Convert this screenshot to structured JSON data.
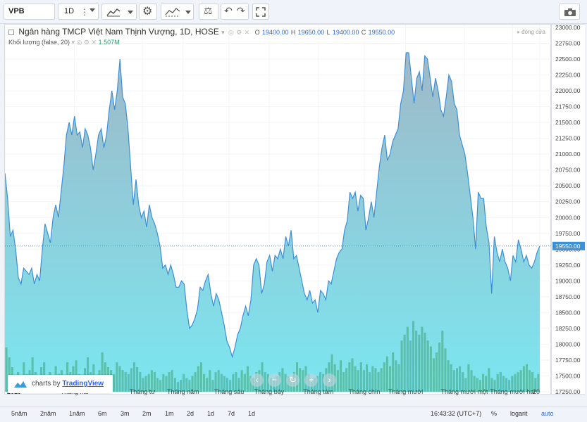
{
  "toolbar": {
    "symbol": "VPB",
    "interval": "1D",
    "icons": [
      "more-icon",
      "dropdown-icon",
      "area-style-icon",
      "dropdown-icon",
      "settings-icon",
      "indicators-icon",
      "dropdown-icon",
      "compare-icon",
      "undo-icon",
      "redo-icon",
      "fullscreen-icon",
      "camera-icon"
    ]
  },
  "legend": {
    "title": "Ngân hàng TMCP Việt Nam Thịnh Vượng, 1D, HOSE",
    "o_label": "O",
    "o_value": "19400.00",
    "h_label": "H",
    "h_value": "19650.00",
    "l_label": "L",
    "l_value": "19400.00",
    "c_label": "C",
    "c_value": "19550.00",
    "volume_label": "Khối lượng (false, 20)",
    "volume_value": "1.507M",
    "close_label": "đóng cửa"
  },
  "watermark": {
    "prefix": "charts by",
    "brand": "TradingView"
  },
  "bottom": {
    "ranges": [
      "5năm",
      "2năm",
      "1năm",
      "6m",
      "3m",
      "2m",
      "1m",
      "2d",
      "1d",
      "7d",
      "1d"
    ],
    "time": "16:43:32 (UTC+7)",
    "pct": "%",
    "log": "logarit",
    "auto": "auto"
  },
  "colors": {
    "line": "#3d8fd8",
    "volume": "#3fa276",
    "area_top": "#9fb9c8",
    "area_bottom": "#7be6f0",
    "last_price_bg": "#3d8fd8"
  },
  "chart_data": {
    "type": "area",
    "ylim": [
      17250,
      23000
    ],
    "y_ticks": [
      17250,
      17500,
      17750,
      18000,
      18250,
      18500,
      18750,
      19000,
      19250,
      19500,
      19750,
      20000,
      20250,
      20500,
      20750,
      21000,
      21250,
      21500,
      21750,
      22000,
      22250,
      22500,
      22750,
      23000
    ],
    "last_price": "19550.00",
    "x_tick_labels": [
      "2019",
      "Tháng hai",
      "Tháng tư",
      "Tháng năm",
      "Tháng sáu",
      "Tháng bảy",
      "Tháng tám",
      "Tháng chín",
      "Tháng mười",
      "Tháng mười một",
      "Tháng mười hai",
      "20"
    ],
    "x_tick_pos": [
      0.0,
      0.13,
      0.257,
      0.333,
      0.419,
      0.494,
      0.586,
      0.672,
      0.749,
      0.859,
      0.949,
      1.0
    ],
    "points": [
      [
        0.0,
        20700
      ],
      [
        0.005,
        20300
      ],
      [
        0.01,
        19700
      ],
      [
        0.015,
        19800
      ],
      [
        0.02,
        19500
      ],
      [
        0.025,
        19050
      ],
      [
        0.03,
        18950
      ],
      [
        0.035,
        19200
      ],
      [
        0.04,
        19150
      ],
      [
        0.045,
        19100
      ],
      [
        0.05,
        19200
      ],
      [
        0.055,
        18950
      ],
      [
        0.06,
        19100
      ],
      [
        0.065,
        19000
      ],
      [
        0.07,
        19500
      ],
      [
        0.075,
        19900
      ],
      [
        0.08,
        19750
      ],
      [
        0.085,
        19600
      ],
      [
        0.09,
        20000
      ],
      [
        0.095,
        20200
      ],
      [
        0.1,
        20000
      ],
      [
        0.105,
        20400
      ],
      [
        0.11,
        20800
      ],
      [
        0.115,
        21300
      ],
      [
        0.12,
        21500
      ],
      [
        0.125,
        21300
      ],
      [
        0.13,
        21600
      ],
      [
        0.135,
        21300
      ],
      [
        0.14,
        21350
      ],
      [
        0.145,
        21100
      ],
      [
        0.15,
        21400
      ],
      [
        0.155,
        21300
      ],
      [
        0.16,
        21100
      ],
      [
        0.165,
        20750
      ],
      [
        0.17,
        21000
      ],
      [
        0.175,
        21300
      ],
      [
        0.18,
        21400
      ],
      [
        0.185,
        21100
      ],
      [
        0.19,
        21300
      ],
      [
        0.195,
        21700
      ],
      [
        0.2,
        22000
      ],
      [
        0.205,
        21700
      ],
      [
        0.21,
        22000
      ],
      [
        0.215,
        22500
      ],
      [
        0.22,
        21900
      ],
      [
        0.225,
        21800
      ],
      [
        0.23,
        21400
      ],
      [
        0.235,
        20800
      ],
      [
        0.24,
        20200
      ],
      [
        0.245,
        20600
      ],
      [
        0.25,
        20200
      ],
      [
        0.255,
        20000
      ],
      [
        0.26,
        20100
      ],
      [
        0.265,
        19850
      ],
      [
        0.27,
        20200
      ],
      [
        0.275,
        20000
      ],
      [
        0.28,
        19900
      ],
      [
        0.285,
        19750
      ],
      [
        0.29,
        19550
      ],
      [
        0.295,
        19200
      ],
      [
        0.3,
        19250
      ],
      [
        0.305,
        19100
      ],
      [
        0.31,
        19250
      ],
      [
        0.315,
        19100
      ],
      [
        0.32,
        18900
      ],
      [
        0.325,
        18900
      ],
      [
        0.33,
        19000
      ],
      [
        0.335,
        18950
      ],
      [
        0.34,
        18550
      ],
      [
        0.345,
        18250
      ],
      [
        0.35,
        18300
      ],
      [
        0.355,
        18400
      ],
      [
        0.36,
        18550
      ],
      [
        0.365,
        18900
      ],
      [
        0.37,
        18850
      ],
      [
        0.375,
        19000
      ],
      [
        0.38,
        19100
      ],
      [
        0.385,
        18800
      ],
      [
        0.39,
        18600
      ],
      [
        0.395,
        18800
      ],
      [
        0.4,
        18700
      ],
      [
        0.405,
        18500
      ],
      [
        0.41,
        18300
      ],
      [
        0.415,
        18050
      ],
      [
        0.42,
        17950
      ],
      [
        0.425,
        17800
      ],
      [
        0.43,
        17950
      ],
      [
        0.435,
        18150
      ],
      [
        0.44,
        18250
      ],
      [
        0.445,
        18450
      ],
      [
        0.45,
        18600
      ],
      [
        0.455,
        18450
      ],
      [
        0.46,
        18700
      ],
      [
        0.465,
        19250
      ],
      [
        0.47,
        19350
      ],
      [
        0.475,
        19250
      ],
      [
        0.48,
        18800
      ],
      [
        0.485,
        18950
      ],
      [
        0.49,
        19300
      ],
      [
        0.495,
        19400
      ],
      [
        0.5,
        19150
      ],
      [
        0.505,
        19400
      ],
      [
        0.51,
        19350
      ],
      [
        0.515,
        19500
      ],
      [
        0.52,
        19350
      ],
      [
        0.525,
        19700
      ],
      [
        0.53,
        19550
      ],
      [
        0.535,
        19800
      ],
      [
        0.54,
        19350
      ],
      [
        0.545,
        19400
      ],
      [
        0.55,
        19200
      ],
      [
        0.555,
        19000
      ],
      [
        0.56,
        18800
      ],
      [
        0.565,
        18700
      ],
      [
        0.57,
        18850
      ],
      [
        0.575,
        18650
      ],
      [
        0.58,
        18700
      ],
      [
        0.585,
        18500
      ],
      [
        0.59,
        18850
      ],
      [
        0.595,
        18800
      ],
      [
        0.6,
        18700
      ],
      [
        0.605,
        19000
      ],
      [
        0.61,
        18950
      ],
      [
        0.615,
        19150
      ],
      [
        0.62,
        19350
      ],
      [
        0.625,
        19450
      ],
      [
        0.63,
        19500
      ],
      [
        0.635,
        19800
      ],
      [
        0.64,
        19950
      ],
      [
        0.645,
        20400
      ],
      [
        0.65,
        20300
      ],
      [
        0.655,
        20400
      ],
      [
        0.66,
        20100
      ],
      [
        0.665,
        20350
      ],
      [
        0.67,
        20300
      ],
      [
        0.675,
        19800
      ],
      [
        0.68,
        20000
      ],
      [
        0.685,
        20250
      ],
      [
        0.69,
        20000
      ],
      [
        0.695,
        20400
      ],
      [
        0.7,
        20800
      ],
      [
        0.705,
        21100
      ],
      [
        0.71,
        21300
      ],
      [
        0.715,
        20900
      ],
      [
        0.72,
        21000
      ],
      [
        0.725,
        21200
      ],
      [
        0.73,
        21300
      ],
      [
        0.735,
        21400
      ],
      [
        0.74,
        21800
      ],
      [
        0.745,
        22000
      ],
      [
        0.75,
        22600
      ],
      [
        0.755,
        22600
      ],
      [
        0.76,
        22200
      ],
      [
        0.765,
        21800
      ],
      [
        0.77,
        22200
      ],
      [
        0.775,
        22300
      ],
      [
        0.78,
        22000
      ],
      [
        0.785,
        22550
      ],
      [
        0.79,
        22500
      ],
      [
        0.795,
        22200
      ],
      [
        0.8,
        21900
      ],
      [
        0.805,
        22200
      ],
      [
        0.81,
        22000
      ],
      [
        0.815,
        21700
      ],
      [
        0.82,
        21600
      ],
      [
        0.825,
        21900
      ],
      [
        0.83,
        22250
      ],
      [
        0.835,
        22150
      ],
      [
        0.84,
        21800
      ],
      [
        0.845,
        21700
      ],
      [
        0.85,
        21300
      ],
      [
        0.855,
        21150
      ],
      [
        0.86,
        21000
      ],
      [
        0.865,
        20700
      ],
      [
        0.87,
        20350
      ],
      [
        0.875,
        20000
      ],
      [
        0.88,
        19500
      ],
      [
        0.885,
        20400
      ],
      [
        0.89,
        20300
      ],
      [
        0.895,
        20300
      ],
      [
        0.9,
        19850
      ],
      [
        0.905,
        19600
      ],
      [
        0.91,
        18800
      ],
      [
        0.915,
        19700
      ],
      [
        0.92,
        19450
      ],
      [
        0.925,
        19300
      ],
      [
        0.93,
        19500
      ],
      [
        0.935,
        19300
      ],
      [
        0.94,
        19200
      ],
      [
        0.945,
        19000
      ],
      [
        0.95,
        19400
      ],
      [
        0.955,
        19300
      ],
      [
        0.96,
        19650
      ],
      [
        0.965,
        19500
      ],
      [
        0.97,
        19300
      ],
      [
        0.975,
        19400
      ],
      [
        0.98,
        19250
      ],
      [
        0.985,
        19200
      ],
      [
        0.99,
        19300
      ],
      [
        0.995,
        19450
      ],
      [
        1.0,
        19550
      ]
    ],
    "volume": [
      0.45,
      0.35,
      0.25,
      0.15,
      0.2,
      0.12,
      0.3,
      0.18,
      0.22,
      0.35,
      0.2,
      0.16,
      0.25,
      0.3,
      0.14,
      0.2,
      0.12,
      0.26,
      0.18,
      0.22,
      0.14,
      0.3,
      0.2,
      0.26,
      0.32,
      0.18,
      0.14,
      0.24,
      0.35,
      0.2,
      0.28,
      0.16,
      0.22,
      0.4,
      0.3,
      0.25,
      0.22,
      0.18,
      0.3,
      0.26,
      0.22,
      0.2,
      0.18,
      0.24,
      0.3,
      0.25,
      0.2,
      0.14,
      0.16,
      0.18,
      0.22,
      0.2,
      0.14,
      0.12,
      0.18,
      0.16,
      0.2,
      0.22,
      0.14,
      0.1,
      0.12,
      0.18,
      0.14,
      0.12,
      0.16,
      0.2,
      0.26,
      0.3,
      0.18,
      0.14,
      0.22,
      0.12,
      0.2,
      0.22,
      0.18,
      0.16,
      0.14,
      0.12,
      0.18,
      0.2,
      0.14,
      0.22,
      0.18,
      0.26,
      0.16,
      0.14,
      0.2,
      0.22,
      0.3,
      0.2,
      0.18,
      0.14,
      0.12,
      0.16,
      0.2,
      0.24,
      0.18,
      0.16,
      0.14,
      0.2,
      0.3,
      0.24,
      0.22,
      0.26,
      0.18,
      0.12,
      0.14,
      0.16,
      0.2,
      0.18,
      0.24,
      0.3,
      0.38,
      0.28,
      0.22,
      0.32,
      0.2,
      0.24,
      0.3,
      0.34,
      0.26,
      0.22,
      0.3,
      0.22,
      0.28,
      0.2,
      0.26,
      0.24,
      0.2,
      0.24,
      0.3,
      0.36,
      0.26,
      0.4,
      0.32,
      0.28,
      0.52,
      0.58,
      0.66,
      0.52,
      0.72,
      0.62,
      0.58,
      0.66,
      0.6,
      0.52,
      0.46,
      0.34,
      0.4,
      0.5,
      0.62,
      0.44,
      0.32,
      0.28,
      0.22,
      0.24,
      0.26,
      0.2,
      0.14,
      0.28,
      0.22,
      0.16,
      0.14,
      0.12,
      0.18,
      0.16,
      0.24,
      0.14,
      0.12,
      0.18,
      0.2,
      0.16,
      0.14,
      0.12,
      0.16,
      0.18,
      0.2,
      0.22,
      0.26,
      0.28,
      0.22,
      0.2,
      0.14,
      0.18
    ]
  }
}
